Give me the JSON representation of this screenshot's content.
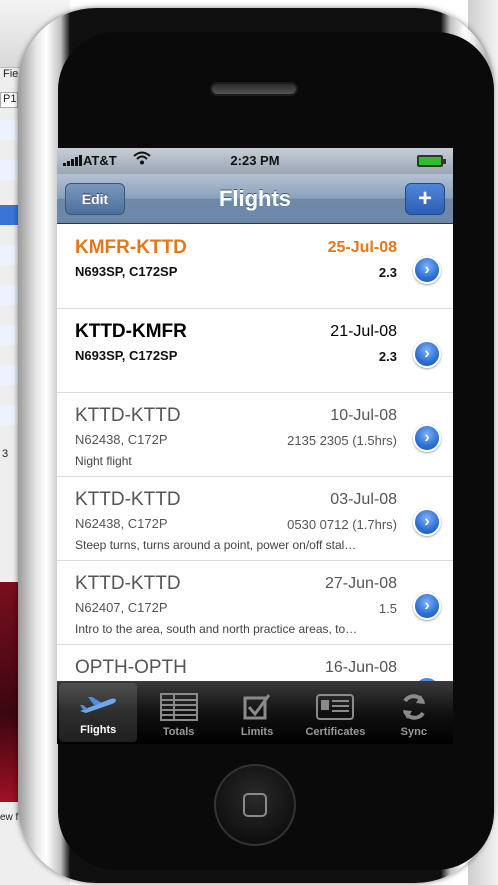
{
  "background_window": {
    "menu_label": "Fie",
    "field_label": "P1",
    "count_label": "3",
    "footer_text": "ew f"
  },
  "status_bar": {
    "carrier": "AT&T",
    "time": "2:23 PM",
    "battery_icon": "battery-charging-icon",
    "wifi_icon": "wifi-icon"
  },
  "nav_bar": {
    "title": "Flights",
    "edit_label": "Edit",
    "add_label": "+"
  },
  "flights": [
    {
      "route": "KMFR-KTTD",
      "date": "25-Jul-08",
      "aircraft": "N693SP, C172SP",
      "duration": "2.3",
      "notes": "",
      "style": "highlight"
    },
    {
      "route": "KTTD-KMFR",
      "date": "21-Jul-08",
      "aircraft": "N693SP, C172SP",
      "duration": "2.3",
      "notes": "",
      "style": "bold"
    },
    {
      "route": "KTTD-KTTD",
      "date": "10-Jul-08",
      "aircraft": "N62438, C172P",
      "duration": "2135 2305 (1.5hrs)",
      "notes": "Night flight",
      "style": "normal"
    },
    {
      "route": "KTTD-KTTD",
      "date": "03-Jul-08",
      "aircraft": "N62438, C172P",
      "duration": "0530 0712 (1.7hrs)",
      "notes": "Steep turns, turns around a point, power on/off stal…",
      "style": "normal"
    },
    {
      "route": "KTTD-KTTD",
      "date": "27-Jun-08",
      "aircraft": "N62407, C172P",
      "duration": "1.5",
      "notes": "Intro to the area, south and north practice areas, to…",
      "style": "normal"
    },
    {
      "route": "OPTH-OPTH",
      "date": "16-Jun-08",
      "aircraft": "",
      "duration": "",
      "notes": "",
      "style": "normal"
    }
  ],
  "tab_bar": {
    "tabs": [
      {
        "label": "Flights",
        "icon": "airplane-icon",
        "active": true
      },
      {
        "label": "Totals",
        "icon": "totals-icon",
        "active": false
      },
      {
        "label": "Limits",
        "icon": "checkbox-icon",
        "active": false
      },
      {
        "label": "Certificates",
        "icon": "certificate-icon",
        "active": false
      },
      {
        "label": "Sync",
        "icon": "sync-icon",
        "active": false
      }
    ]
  },
  "colors": {
    "highlight": "#e3771a",
    "nav_blue": "#6c87a7",
    "disclosure_blue": "#2c6fd4"
  }
}
